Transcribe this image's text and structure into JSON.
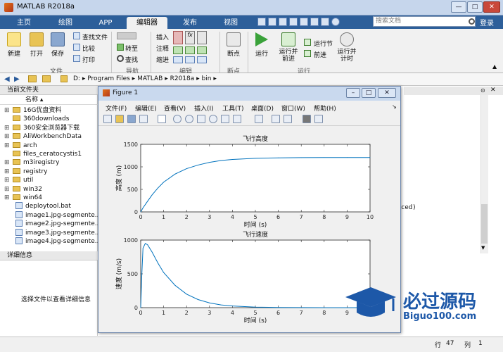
{
  "window": {
    "title": "MATLAB R2018a",
    "min": "—",
    "max": "□",
    "close": "✕"
  },
  "tabs": [
    "主页",
    "绘图",
    "APP",
    "编辑器",
    "发布",
    "视图"
  ],
  "active_tab": "编辑器",
  "search": {
    "placeholder": "搜索文档"
  },
  "login": "登录",
  "ribbon": {
    "file": {
      "new": "新建",
      "open": "打开",
      "save": "保存",
      "find_files": "查找文件",
      "compare": "比较",
      "print": "打印",
      "label": "文件"
    },
    "nav": {
      "goto": "转至",
      "find": "查找",
      "label": "导航"
    },
    "edit": {
      "insert": "插入",
      "comment": "注释",
      "indent": "缩进",
      "label": "编辑"
    },
    "breakpoints": {
      "btn": "断点",
      "label": "断点"
    },
    "run": {
      "run": "运行",
      "run_advance": "运行并\n前进",
      "run_section": "运行节",
      "advance": "前进",
      "run_time": "运行并\n计时",
      "label": "运行"
    }
  },
  "path": [
    "D:",
    "Program Files",
    "MATLAB",
    "R2018a",
    "bin"
  ],
  "current_folder": {
    "title": "当前文件夹",
    "col_name": "名称 ▴",
    "items": [
      {
        "name": "16G优盘资料",
        "type": "folder",
        "expand": "⊞"
      },
      {
        "name": "360downloads",
        "type": "folder",
        "expand": ""
      },
      {
        "name": "360安全浏览器下载",
        "type": "folder",
        "expand": "⊞"
      },
      {
        "name": "AliWorkbenchData",
        "type": "folder",
        "expand": "⊞"
      },
      {
        "name": "arch",
        "type": "folder",
        "expand": "⊞"
      },
      {
        "name": "files_ceratocystis1",
        "type": "folder",
        "expand": ""
      },
      {
        "name": "m3iregistry",
        "type": "folder",
        "expand": "⊞"
      },
      {
        "name": "registry",
        "type": "folder",
        "expand": "⊞"
      },
      {
        "name": "util",
        "type": "folder",
        "expand": "⊞"
      },
      {
        "name": "win32",
        "type": "folder",
        "expand": "⊞"
      },
      {
        "name": "win64",
        "type": "folder",
        "expand": "⊞"
      },
      {
        "name": "deploytool.bat",
        "type": "file",
        "expand": ""
      },
      {
        "name": "image1.jpg-segmente...",
        "type": "file",
        "expand": ""
      },
      {
        "name": "image2.jpg-segmente...",
        "type": "file",
        "expand": ""
      },
      {
        "name": "image3.jpg-segmente...",
        "type": "file",
        "expand": ""
      },
      {
        "name": "image4.jpg-segmente...",
        "type": "file",
        "expand": ""
      }
    ]
  },
  "details": {
    "title": "详细信息",
    "hint": "选择文件以查看详细信息"
  },
  "editor_fragment": "ced)",
  "figure": {
    "title": "Figure 1",
    "menus": [
      "文件(F)",
      "编辑(E)",
      "查看(V)",
      "插入(I)",
      "工具(T)",
      "桌面(D)",
      "窗口(W)",
      "帮助(H)"
    ]
  },
  "status": {
    "row_label": "行",
    "row": "47",
    "col_label": "列",
    "col": "1"
  },
  "watermark": {
    "text": "必过源码",
    "sub": "Biguo100.com"
  },
  "colors": {
    "accent": "#2d5f9a",
    "curve": "#0072bd"
  },
  "chart_data": [
    {
      "type": "line",
      "title": "飞行高度",
      "xlabel": "时间 (s)",
      "ylabel": "高度 (m)",
      "xlim": [
        0,
        10
      ],
      "ylim": [
        0,
        1500
      ],
      "xticks": [
        0,
        1,
        2,
        3,
        4,
        5,
        6,
        7,
        8,
        9,
        10
      ],
      "yticks": [
        0,
        500,
        1000,
        1500
      ],
      "x": [
        0,
        0.1,
        0.25,
        0.5,
        0.75,
        1,
        1.5,
        2,
        2.5,
        3,
        3.5,
        4,
        5,
        6,
        7,
        8,
        9,
        10
      ],
      "y": [
        0,
        90,
        200,
        380,
        530,
        660,
        840,
        960,
        1040,
        1100,
        1140,
        1165,
        1190,
        1200,
        1205,
        1207,
        1208,
        1208
      ]
    },
    {
      "type": "line",
      "title": "飞行速度",
      "xlabel": "时间 (s)",
      "ylabel": "速度 (m/s)",
      "xlim": [
        0,
        10
      ],
      "ylim": [
        0,
        1000
      ],
      "xticks": [
        0,
        1,
        2,
        3,
        4,
        5,
        6,
        7,
        8,
        9,
        10
      ],
      "yticks": [
        0,
        500,
        1000
      ],
      "x": [
        0,
        0.05,
        0.1,
        0.2,
        0.3,
        0.5,
        0.75,
        1,
        1.5,
        2,
        2.5,
        3,
        3.5,
        4,
        5,
        6,
        7,
        8,
        9,
        10
      ],
      "y": [
        0,
        500,
        880,
        950,
        930,
        820,
        660,
        520,
        330,
        200,
        120,
        70,
        40,
        25,
        8,
        3,
        1,
        0,
        0,
        0
      ]
    }
  ]
}
